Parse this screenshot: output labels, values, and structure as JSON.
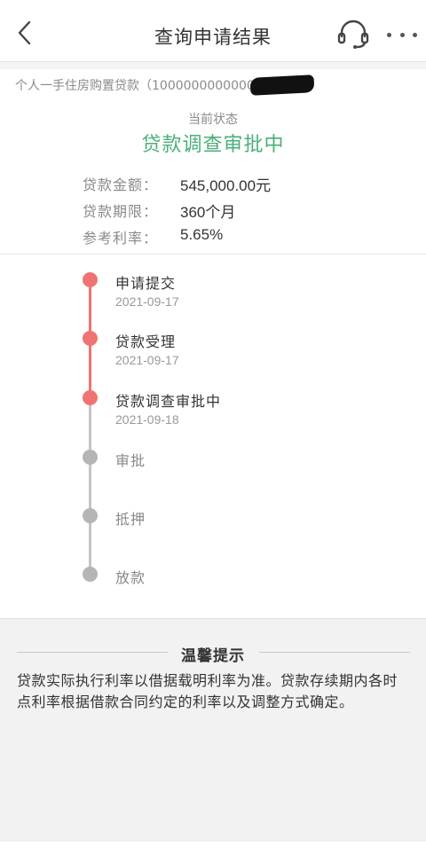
{
  "header": {
    "title": "查询申请结果",
    "back_icon": "chevron-left-icon",
    "service_icon": "headset-icon",
    "more_icon": "more-dots-icon"
  },
  "loan": {
    "product": "个人一手住房购置贷款（1000000000000",
    "status_label": "当前状态",
    "status_value": "贷款调查审批中",
    "status_color": "#4caf7a",
    "details": [
      {
        "key": "贷款金额：",
        "value": "545,000.00元"
      },
      {
        "key": "贷款期限：",
        "value": "360个月"
      },
      {
        "key": "参考利率：",
        "value": "5.65%"
      }
    ]
  },
  "timeline": {
    "active_color": "#f07373",
    "pending_color": "#b5b5b5",
    "steps": [
      {
        "title": "申请提交",
        "date": "2021-09-17",
        "done": true
      },
      {
        "title": "贷款受理",
        "date": "2021-09-17",
        "done": true
      },
      {
        "title": "贷款调查审批中",
        "date": "2021-09-18",
        "done": true
      },
      {
        "title": "审批",
        "date": "",
        "done": false
      },
      {
        "title": "抵押",
        "date": "",
        "done": false
      },
      {
        "title": "放款",
        "date": "",
        "done": false
      }
    ]
  },
  "tips": {
    "title": "温馨提示",
    "text": "贷款实际执行利率以借据载明利率为准。贷款存续期内各时点利率根据借款合同约定的利率以及调整方式确定。"
  }
}
